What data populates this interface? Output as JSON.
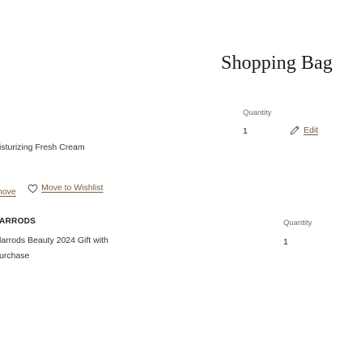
{
  "header": {
    "title": "Shopping Bag"
  },
  "items": [
    {
      "name": "isturizing Fresh Cream",
      "quantity_label": "Quantity",
      "quantity_value": "1",
      "edit_label": "Edit",
      "remove_label": "nove",
      "wishlist_label": "Move to Wishlist"
    },
    {
      "brand": "ARRODS",
      "name_line1": "larrods Beauty 2024 Gift with",
      "name_line2": "urchase",
      "quantity_label": "Quantity",
      "quantity_value": "1"
    }
  ],
  "icons": {
    "edit": "pencil-icon",
    "wishlist": "heart-icon"
  },
  "colors": {
    "link": "#7a5a3c",
    "text": "#2b2b2b",
    "muted": "#6d6d6d"
  }
}
